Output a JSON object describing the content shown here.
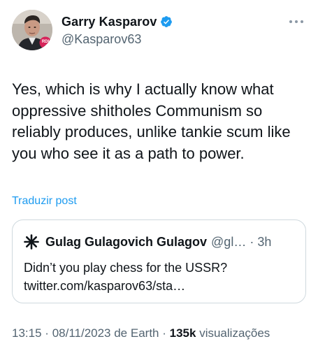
{
  "author": {
    "display_name": "Garry Kasparov",
    "handle": "@Kasparov63",
    "avatar_badge": "RDI",
    "verified": true
  },
  "tweet": {
    "text": "Yes, which is why I actually know what oppressive shitholes Communism so reliably produces, unlike tankie scum like you who see it as a path to power.",
    "translate_label": "Traduzir post"
  },
  "quoted_tweet": {
    "author_name": "Gulag Gulagovich Gulagov",
    "handle": "@gl…",
    "separator": "·",
    "time": "3h",
    "text_line1": "Didn’t you play chess for the USSR?",
    "text_line2": "twitter.com/kasparov63/sta…",
    "avatar_icon": "asterisk-icon"
  },
  "meta": {
    "time": "13:15",
    "separator": "·",
    "date": "08/11/2023 de Earth",
    "views_count": "135k",
    "views_label": "visualizações"
  },
  "colors": {
    "link": "#1d9bf0",
    "verified": "#1d9bf0",
    "secondary_text": "#536471",
    "primary_text": "#0f1419",
    "border": "#cfd9de"
  }
}
